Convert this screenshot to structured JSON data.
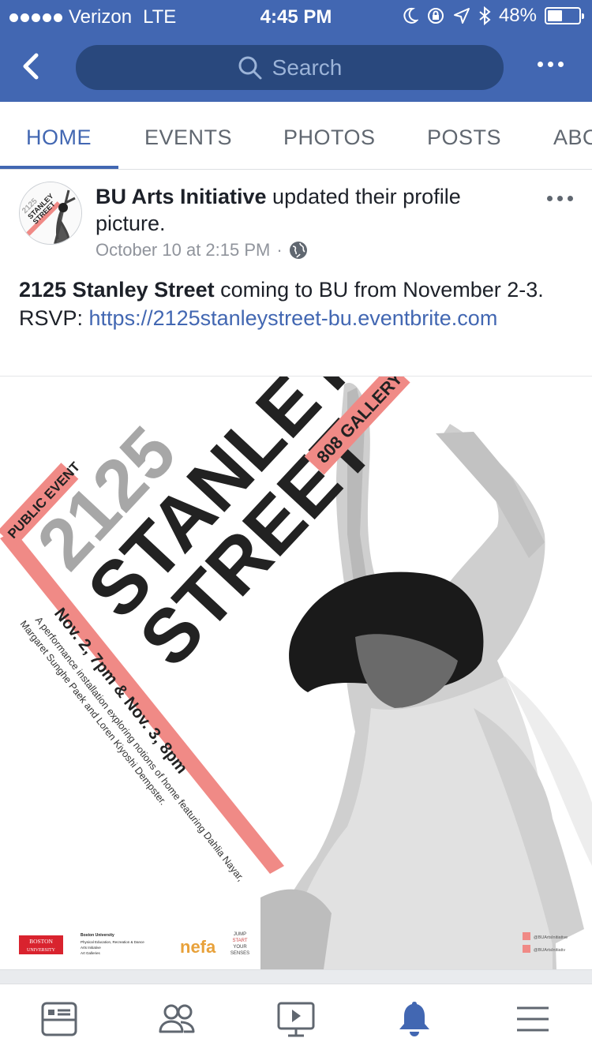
{
  "status_bar": {
    "carrier": "Verizon",
    "network": "LTE",
    "time": "4:45 PM",
    "battery": "48%",
    "battery_level": 0.48
  },
  "nav": {
    "search_placeholder": "Search"
  },
  "tabs": [
    {
      "label": "HOME",
      "active": true
    },
    {
      "label": "EVENTS",
      "active": false
    },
    {
      "label": "PHOTOS",
      "active": false
    },
    {
      "label": "POSTS",
      "active": false
    },
    {
      "label": "ABO",
      "active": false
    }
  ],
  "post": {
    "author": "BU Arts Initiative",
    "action": " updated their profile picture.",
    "timestamp": "October 10 at 2:15 PM",
    "separator": "·",
    "body_bold": "2125 Stanley Street",
    "body_text": " coming to BU from November 2-3. RSVP: ",
    "body_link": "https://2125stanleystreet-bu.eventbrite.com"
  },
  "poster": {
    "tag": "PUBLIC EVENT",
    "number": "2125",
    "title_1": "STANLEY",
    "title_2": "STREET",
    "venue": "808 GALLERY",
    "dates": "Nov. 2, 7pm & Nov. 3, 8pm",
    "desc_1": "A performance installation exploring notions of home featuring Dahlia Nayar,",
    "desc_2": "Margaret Sunghe Paek and Loren Kiyoshi Dempster.",
    "bu_logo_1": "BOSTON",
    "bu_logo_2": "UNIVERSITY",
    "org_1": "Boston University",
    "org_2": "Physical Education, Recreation & Dance",
    "org_3": "Arts Initiative",
    "org_4": "Art Galleries",
    "nefa": "nefa",
    "jump_1": "JUMP",
    "jump_2": "START",
    "jump_3": "YOUR",
    "jump_4": "SENSES",
    "social_1": "@BUArtsInitiative",
    "social_2": "@BUArtsInitiativ",
    "colors": {
      "accent": "#f08a86",
      "dark": "#222222",
      "grey": "#a7a7a7"
    }
  },
  "avatar": {
    "line_1": "2125",
    "line_2": "STANLEY",
    "line_3": "STREET"
  },
  "bottom_tabs": [
    {
      "icon": "news-feed-icon",
      "active": false
    },
    {
      "icon": "friends-icon",
      "active": false
    },
    {
      "icon": "watch-video-icon",
      "active": false
    },
    {
      "icon": "notifications-bell-icon",
      "active": true
    },
    {
      "icon": "menu-icon",
      "active": false
    }
  ],
  "colors": {
    "brand": "#4267b2",
    "brand_dark": "#29487d",
    "meta": "#90949c"
  }
}
